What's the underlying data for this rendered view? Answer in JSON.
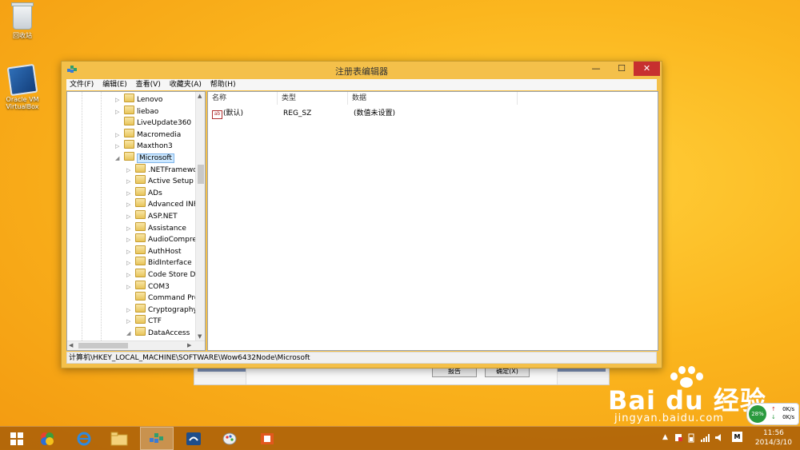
{
  "desktop": {
    "recycle_bin": "回收站",
    "virtualbox_line1": "Oracle VM",
    "virtualbox_line2": "VirtualBox"
  },
  "window": {
    "title": "注册表编辑器",
    "minimize_glyph": "—",
    "maximize_glyph": "☐",
    "close_glyph": "✕",
    "menu": [
      "文件(F)",
      "编辑(E)",
      "查看(V)",
      "收藏夹(A)",
      "帮助(H)"
    ],
    "tree": [
      {
        "label": "Lenovo",
        "expander": "▷"
      },
      {
        "label": "liebao",
        "expander": "▷"
      },
      {
        "label": "LiveUpdate360",
        "expander": ""
      },
      {
        "label": "Macromedia",
        "expander": "▷"
      },
      {
        "label": "Maxthon3",
        "expander": "▷"
      },
      {
        "label": "Microsoft",
        "expander": "◢",
        "selected": true
      },
      {
        "label": ".NETFramewo",
        "expander": "▷"
      },
      {
        "label": "Active Setup",
        "expander": "▷"
      },
      {
        "label": "ADs",
        "expander": "▷"
      },
      {
        "label": "Advanced INF",
        "expander": "▷"
      },
      {
        "label": "ASP.NET",
        "expander": "▷"
      },
      {
        "label": "Assistance",
        "expander": "▷"
      },
      {
        "label": "AudioCompre",
        "expander": "▷"
      },
      {
        "label": "AuthHost",
        "expander": "▷"
      },
      {
        "label": "BidInterface",
        "expander": "▷"
      },
      {
        "label": "Code Store D",
        "expander": "▷"
      },
      {
        "label": "COM3",
        "expander": "▷"
      },
      {
        "label": "Command Pro",
        "expander": ""
      },
      {
        "label": "Cryptography",
        "expander": "▷"
      },
      {
        "label": "CTF",
        "expander": "▷"
      },
      {
        "label": "DataAccess",
        "expander": "◢"
      }
    ],
    "columns": {
      "name": "名称",
      "type": "类型",
      "data": "数据"
    },
    "rows": [
      {
        "icon": "ab",
        "name": "(默认)",
        "type": "REG_SZ",
        "data": "(数值未设置)"
      }
    ],
    "status_path": "计算机\\HKEY_LOCAL_MACHINE\\SOFTWARE\\Wow6432Node\\Microsoft"
  },
  "background_dialog": {
    "button_left": "报告",
    "button_right": "确定(X)"
  },
  "watermark": {
    "brand": "Bai du 经验",
    "url": "jingyan.baidu.com"
  },
  "net_monitor": {
    "percent": "28%",
    "up": "0K/s",
    "down": "0K/s"
  },
  "taskbar": {
    "apps": [
      "start-icon",
      "app-colorful-icon",
      "ie-icon",
      "file-explorer-icon",
      "regedit-icon",
      "shield-app-icon",
      "paint-icon",
      "office-icon"
    ],
    "ime": "M",
    "time": "11:56",
    "date": "2014/3/10"
  }
}
